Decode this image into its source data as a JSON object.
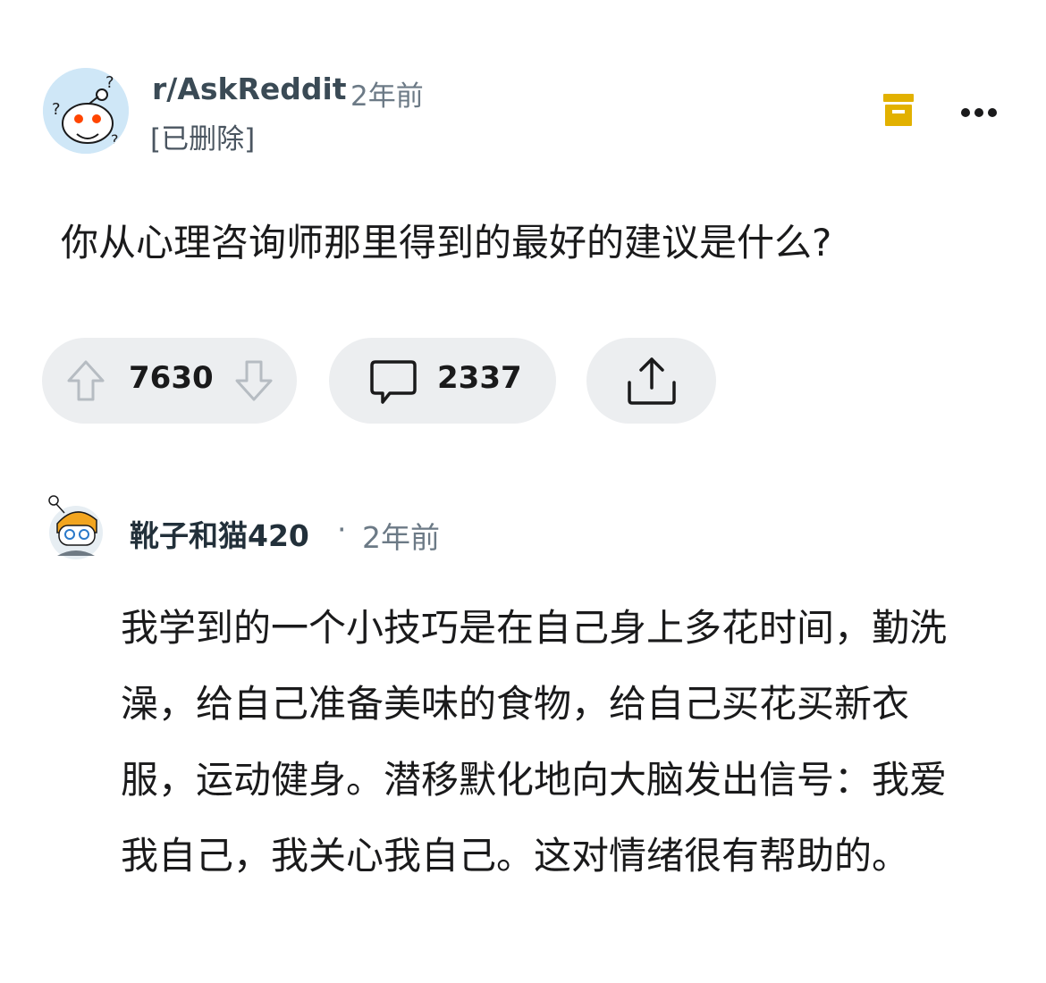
{
  "post": {
    "subreddit": "r/AskReddit",
    "time": "2年前",
    "author": "[已删除]",
    "title": "你从心理咨询师那里得到的最好的建议是什么?",
    "votes": "7630",
    "comments": "2337"
  },
  "comment": {
    "username": "靴子和猫420",
    "separator": "·",
    "time": "2年前",
    "body": "我学到的一个小技巧是在自己身上多花时间，勤洗澡，给自己准备美味的食物，给自己买花买新衣服，运动健身。潜移默化地向大脑发出信号：我爱我自己，我关心我自己。这对情绪很有帮助的。"
  },
  "icons": {
    "archive": "archive-icon",
    "more": "more-options-icon",
    "upvote": "upvote-arrow-icon",
    "downvote": "downvote-arrow-icon",
    "comment": "comment-bubble-icon",
    "share": "share-icon"
  },
  "colors": {
    "archive": "#e2b100",
    "pill_bg": "#eceef0",
    "meta_text": "#6c7a86"
  }
}
